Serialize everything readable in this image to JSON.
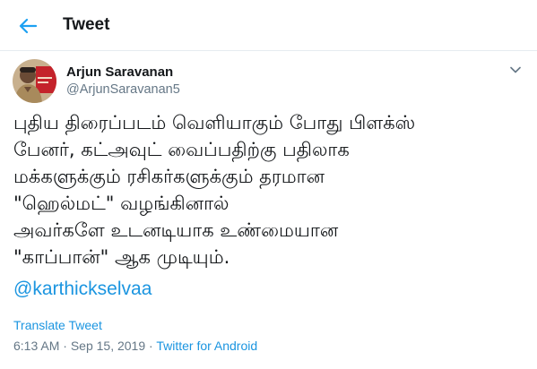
{
  "header": {
    "back_icon": "arrow-left-icon",
    "title": "Tweet",
    "accent_color": "#1da1f2"
  },
  "author": {
    "name": "Arjun Saravanan",
    "handle": "@ArjunSaravanan5",
    "more_icon": "chevron-down-icon"
  },
  "tweet": {
    "lines": [
      "புதிய திரைப்படம் வெளியாகும் போது பிளக்ஸ்",
      "பேனர், கட்அவுட் வைப்பதிற்கு பதிலாக",
      "மக்களுக்கும் ரசிகர்களுக்கும் தரமான",
      "\"ஹெல்மட்\" வழங்கினால்",
      "அவர்களே உடனடியாக உண்மையான",
      "\"காப்பான்\" ஆக முடியும்."
    ],
    "mention": "@karthickselvaa",
    "link_color": "#1b95e0"
  },
  "footer": {
    "translate_label": "Translate Tweet",
    "time": "6:13 AM",
    "date": "Sep 15, 2019",
    "separator": "·",
    "source": "Twitter for Android"
  }
}
